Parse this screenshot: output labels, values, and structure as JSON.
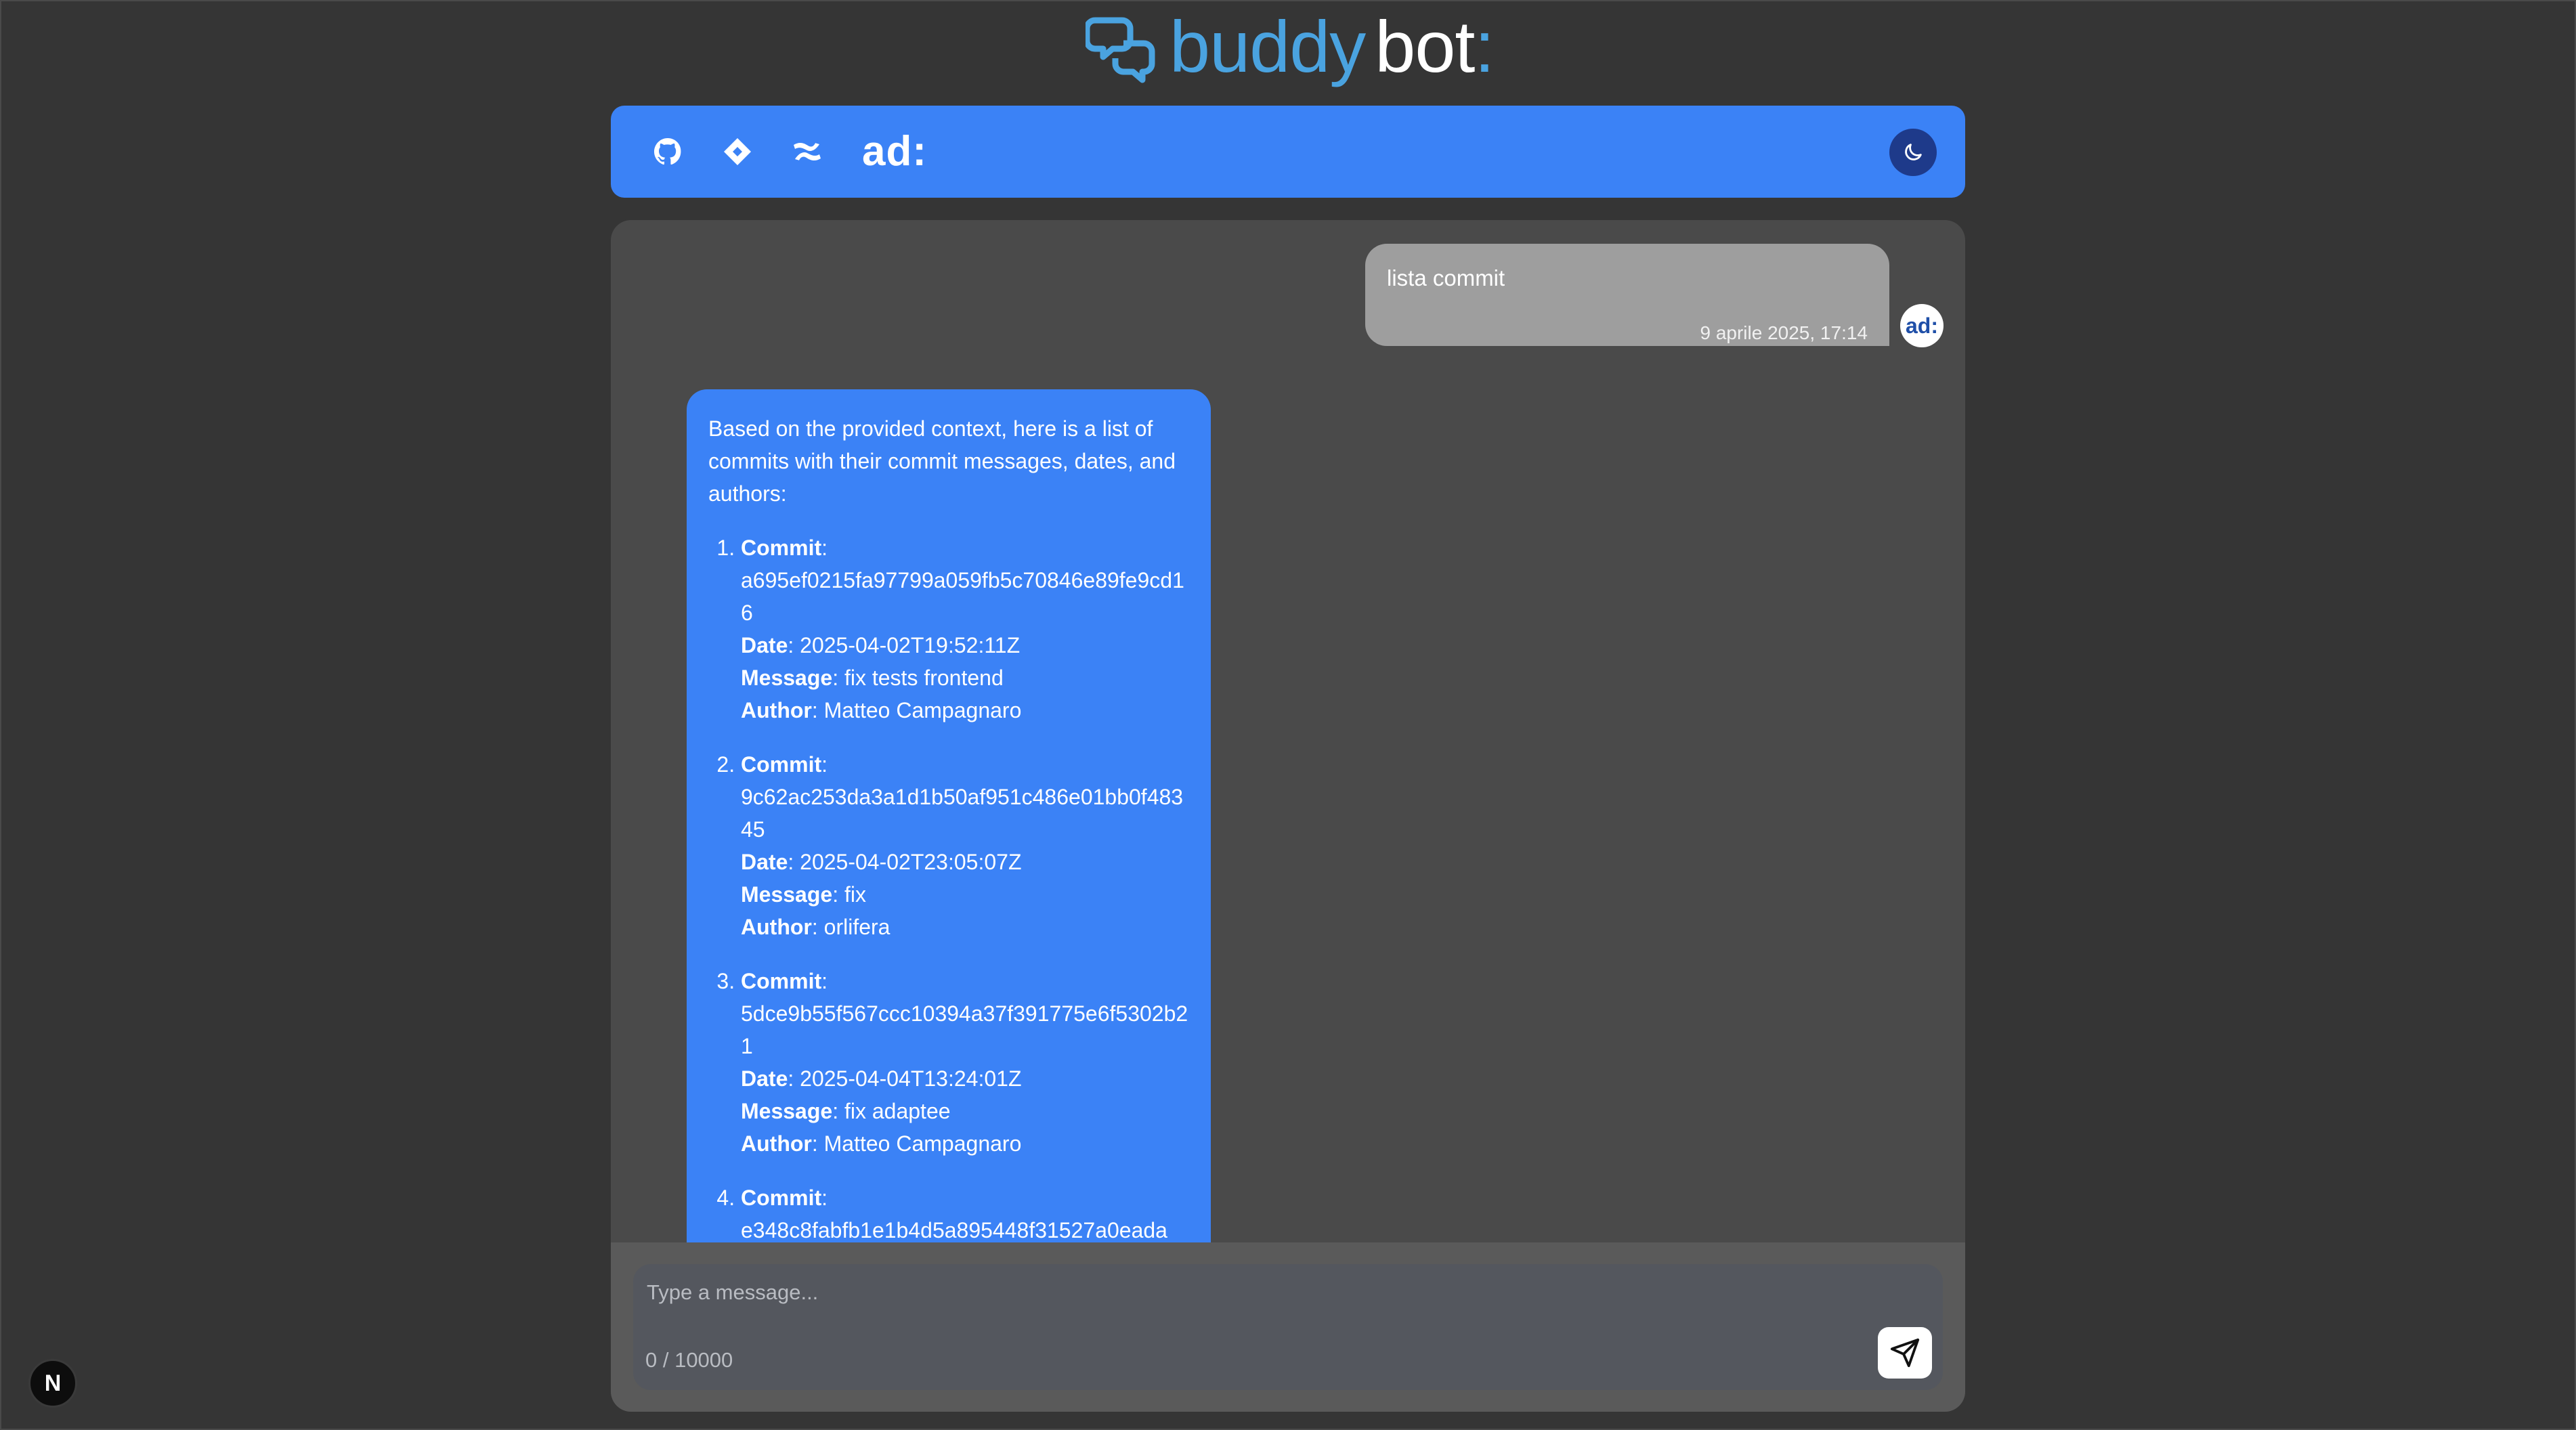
{
  "logo": {
    "word1": "buddy",
    "word2": "bot",
    "suffix": ":"
  },
  "header": {
    "brand": "ad:",
    "icons": [
      "github-icon",
      "jira-icon",
      "confluence-icon"
    ],
    "theme_icon": "moon-icon"
  },
  "colors": {
    "accent": "#3b82f6",
    "page_bg": "#353535",
    "panel_bg": "#4a4a4a",
    "user_bubble": "#9e9e9e",
    "logo_blue": "#4aa3e0"
  },
  "messages": {
    "user": {
      "text": "lista commit",
      "time": "9 aprile 2025, 17:14",
      "avatar": "ad:"
    },
    "bot": {
      "intro": "Based on the provided context, here is a list of commits with their commit messages, dates, and authors:",
      "labels": {
        "commit": "Commit",
        "date": "Date",
        "message": "Message",
        "author": "Author"
      },
      "commits": [
        {
          "hash": "a695ef0215fa97799a059fb5c70846e89fe9cd16",
          "date": "2025-04-02T19:52:11Z",
          "message": "fix tests frontend",
          "author": "Matteo Campagnaro"
        },
        {
          "hash": "9c62ac253da3a1d1b50af951c486e01bb0f48345",
          "date": "2025-04-02T23:05:07Z",
          "message": "fix",
          "author": "orlifera"
        },
        {
          "hash": "5dce9b55f567ccc10394a37f391775e6f5302b21",
          "date": "2025-04-04T13:24:01Z",
          "message": "fix adaptee",
          "author": "Matteo Campagnaro"
        },
        {
          "hash": "e348c8fabfb1e1b4d5a895448f31527a0eada",
          "date": "",
          "message": "",
          "author": ""
        }
      ]
    }
  },
  "input": {
    "placeholder": "Type a message...",
    "counter": "0 / 10000"
  },
  "badge": {
    "letter": "N"
  }
}
